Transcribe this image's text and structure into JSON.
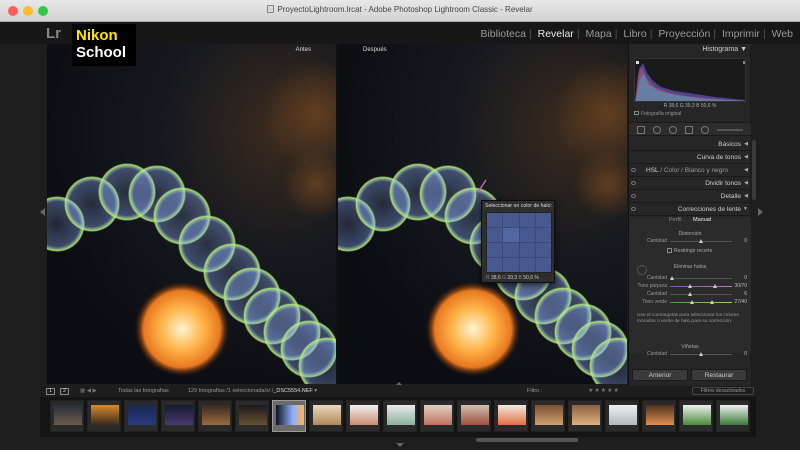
{
  "window": {
    "title": "ProyectoLightroom.lrcat - Adobe Photoshop Lightroom Classic - Revelar"
  },
  "app": {
    "logo": "Lr"
  },
  "brand": {
    "line1": "Nikon",
    "line2": "School"
  },
  "modules": [
    {
      "label": "Biblioteca",
      "active": false
    },
    {
      "label": "Revelar",
      "active": true
    },
    {
      "label": "Mapa",
      "active": false
    },
    {
      "label": "Libro",
      "active": false
    },
    {
      "label": "Proyección",
      "active": false
    },
    {
      "label": "Imprimir",
      "active": false
    },
    {
      "label": "Web",
      "active": false
    }
  ],
  "viewer": {
    "before_label": "Antes",
    "after_label": "Después"
  },
  "popup": {
    "title": "Seleccionar un color de halo:",
    "r_label": "R",
    "r_value": "38,6",
    "g_label": "G",
    "g_value": "39,3",
    "b_label": "B",
    "b_value": "50,6",
    "unit": "%"
  },
  "panel": {
    "histogram_title": "Histograma",
    "histogram_values": "R 38,6  G 39,3  B 50,6 %",
    "original_photo": "Fotografía original",
    "sections": {
      "basicos": "Básicos",
      "curva": "Curva de tonos",
      "hsl": "HSL",
      "color": "Color",
      "bn": "Blanco y negro",
      "dividir": "Dividir tonos",
      "detalle": "Detalle",
      "lente": "Correcciones de lente"
    },
    "lens": {
      "tab_profile": "Perfil",
      "tab_manual": "Manual",
      "distortion": "Distorsión",
      "amount_label": "Cantidad",
      "amount_value": "0",
      "crop_label": "Restringir recorte",
      "defringe": "Eliminar halos",
      "purple_amount_label": "Cantidad",
      "purple_amount_value": "0",
      "purple_hue_label": "Tono púrpura",
      "purple_hue_value": "30/70",
      "green_amount_label": "Cantidad",
      "green_amount_value": "6",
      "green_hue_label": "Tono verde",
      "green_hue_value": "27/40",
      "help": "Use el cuentagotas para seleccionar los colores morados o verde de halo para su corrección.",
      "vignette": "Viñetas",
      "vig_amount_label": "Cantidad",
      "vig_amount_value": "0"
    },
    "btn_prev": "Anterior",
    "btn_reset": "Restaurar"
  },
  "filmstrip_bar": {
    "view1": "1",
    "view2": "2",
    "source": "Todas las fotografías",
    "count": "129 fotografías /1 seleccionada/s/ /",
    "filename": "_DSC5554.NEF",
    "filter_label": "Filtro :",
    "filter_value": "Filtros desactivados"
  },
  "colors": {
    "accent": "#e8e8e8",
    "brand_yellow": "#ffe600",
    "bokeh_green": "#b8f07a",
    "bokeh_blue": "#7fa8ff",
    "orange_light": "#ffb347"
  }
}
